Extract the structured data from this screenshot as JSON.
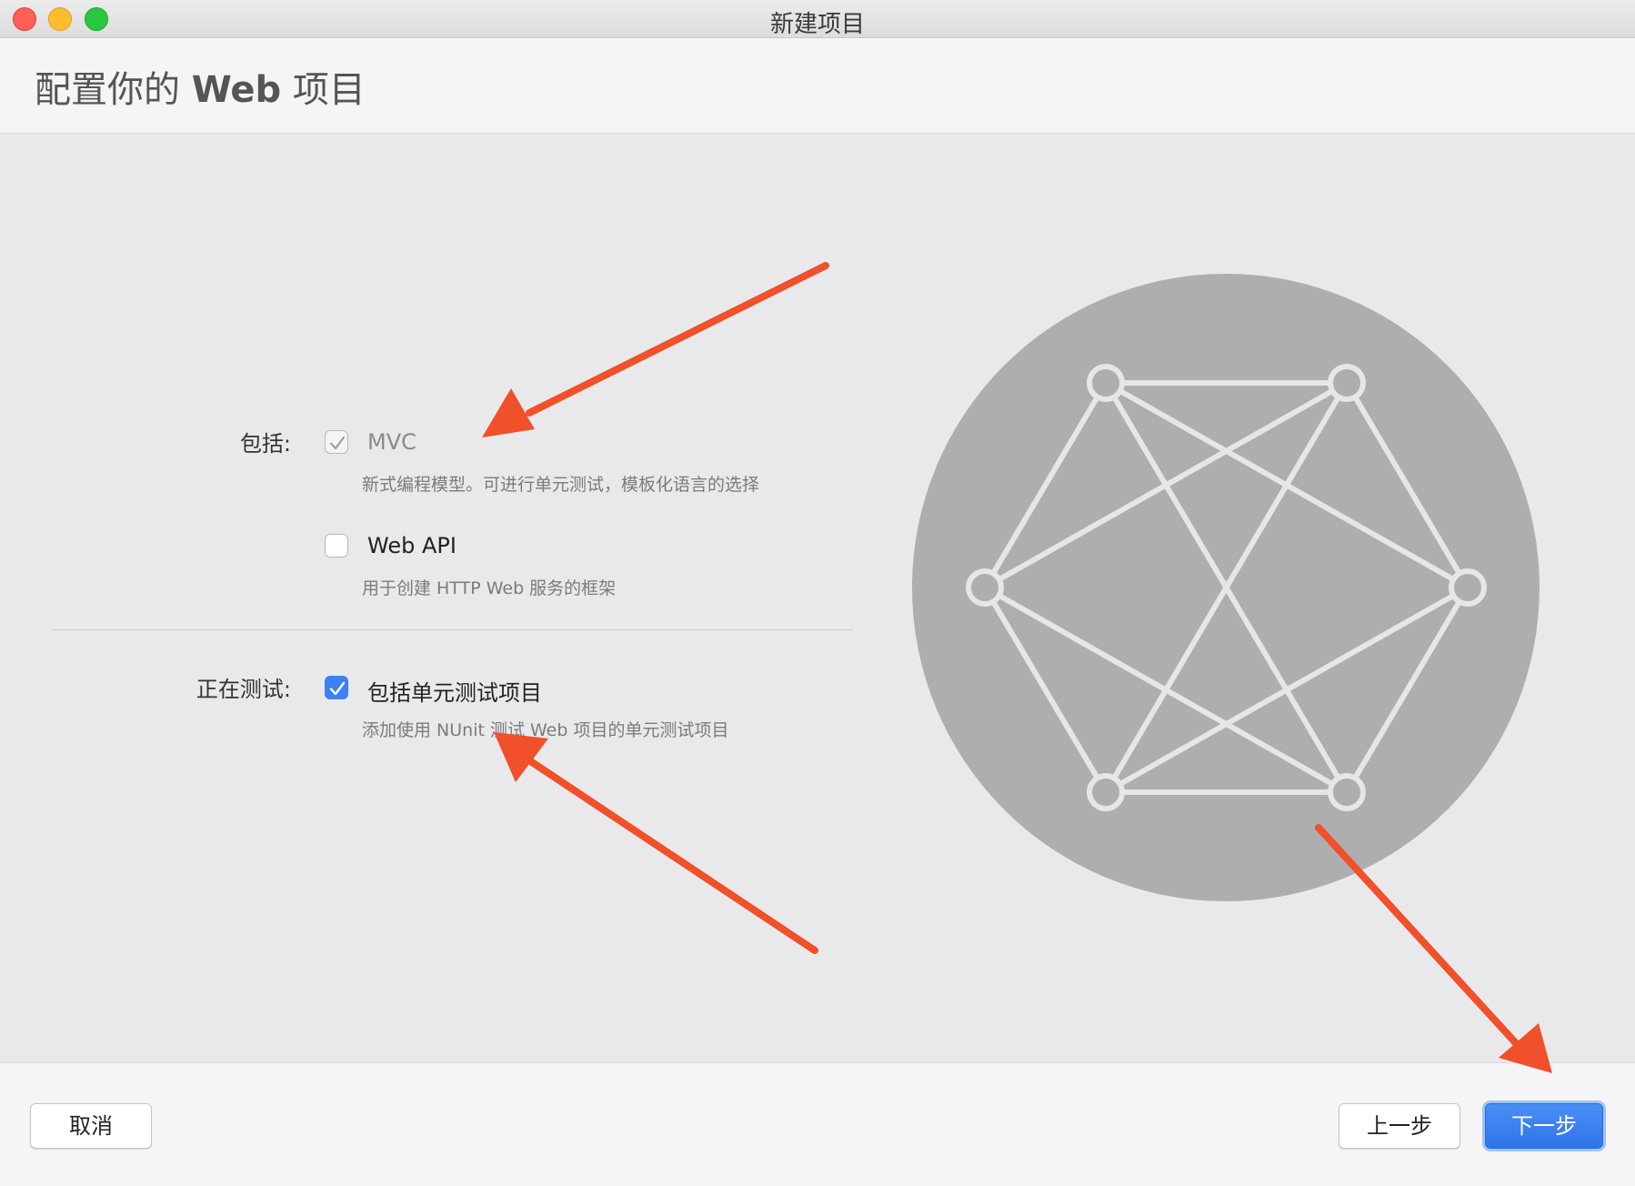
{
  "window": {
    "title": "新建项目"
  },
  "header": {
    "title_prefix": "配置你的 ",
    "title_bold": "Web",
    "title_suffix": " 项目"
  },
  "include_section": {
    "label": "包括:",
    "options": [
      {
        "title": "MVC",
        "description": "新式编程模型。可进行单元测试，模板化语言的选择",
        "checked": true,
        "disabled": true
      },
      {
        "title": "Web API",
        "description": "用于创建 HTTP Web 服务的框架",
        "checked": false,
        "disabled": false
      }
    ]
  },
  "testing_section": {
    "label": "正在测试:",
    "option": {
      "title": "包括单元测试项目",
      "description": "添加使用 NUnit 测试 Web 项目的单元测试项目",
      "checked": true
    }
  },
  "footer": {
    "cancel_label": "取消",
    "back_label": "上一步",
    "next_label": "下一步"
  },
  "colors": {
    "accent": "#3d82f0",
    "annotation_arrow": "#f0502a",
    "illustration_circle": "#aeaeb1",
    "illustration_lines": "#e6e6e8"
  },
  "icons": {
    "illustration": "network-graph-icon",
    "check": "checkmark-icon"
  }
}
